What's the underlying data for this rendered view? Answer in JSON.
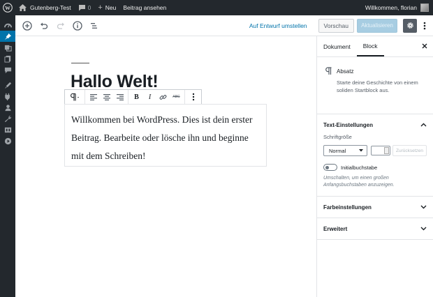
{
  "admin_bar": {
    "site_name": "Gutenberg-Test",
    "comments_count": "0",
    "new_label": "Neu",
    "view_post_label": "Beitrag ansehen",
    "greeting": "Willkommen, florian"
  },
  "admin_menu": {
    "items": [
      "dashboard-icon",
      "posts-icon",
      "media-icon",
      "pages-icon",
      "comments-icon",
      "appearance-icon",
      "plugins-icon",
      "users-icon",
      "tools-icon",
      "settings-icon",
      "collapse-icon"
    ],
    "active_index": 1,
    "active_color": "#0073aa"
  },
  "header": {
    "switch_to_draft": "Auf Entwurf umstellen",
    "preview": "Vorschau",
    "publish_update": "Aktualisieren"
  },
  "editor": {
    "title": "Hallo Welt!",
    "paragraph": "Willkommen bei WordPress. Dies ist dein erster Beitrag. Bearbeite oder lösche ihn und beginne mit dem Schreiben!",
    "strikethrough_label": "ABC"
  },
  "sidebar": {
    "tabs": [
      "Dokument",
      "Block"
    ],
    "active_tab": "Block",
    "block_card": {
      "title": "Absatz",
      "description": "Starte deine Geschichte von einem soliden Startblock aus."
    },
    "text_settings": {
      "title": "Text-Einstellungen",
      "font_size_label": "Schriftgröße",
      "font_size_value": "Normal",
      "reset_label": "Zurücksetzen",
      "drop_cap_label": "Initialbuchstabe",
      "drop_cap_help": "Umschalten, um einen großen Anfangsbuchstaben anzuzeigen."
    },
    "color_settings": {
      "title": "Farbeinstellungen"
    },
    "advanced": {
      "title": "Erweitert"
    }
  }
}
